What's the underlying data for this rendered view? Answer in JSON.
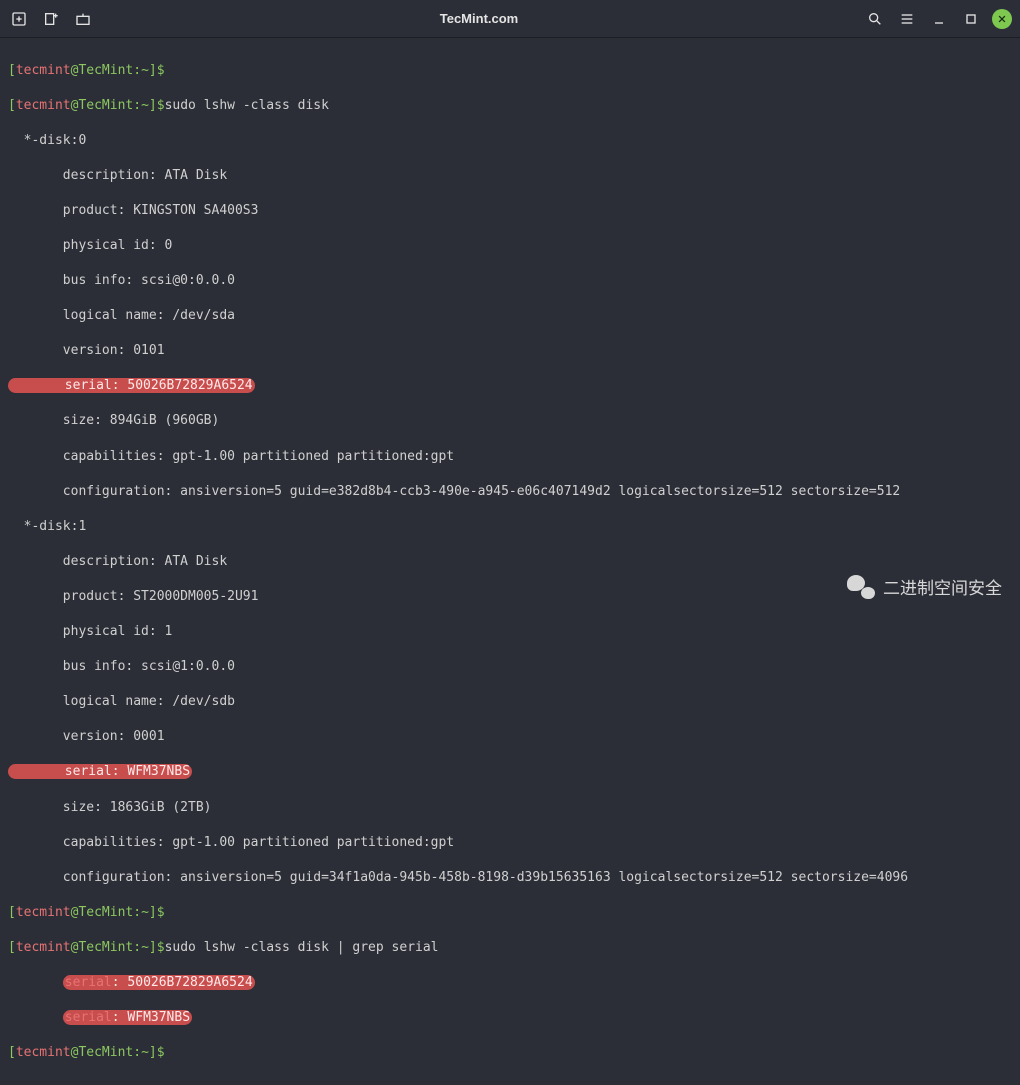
{
  "title": "TecMint.com",
  "prompt": {
    "bracket_open": "[",
    "bracket_close": "]",
    "user": "tecmint",
    "at": "@",
    "host": "TecMint",
    "path": ":~",
    "dollar": "$"
  },
  "cmd1": "sudo lshw -class disk",
  "cmd2": "sudo lshw -class disk | grep serial",
  "disk0": {
    "header": "  *-disk:0",
    "description": "       description: ATA Disk",
    "product": "       product: KINGSTON SA400S3",
    "physical_id": "       physical id: 0",
    "bus": "       bus info: scsi@0:0.0.0",
    "logical": "       logical name: /dev/sda",
    "version": "       version: 0101",
    "serial_label": "       serial: ",
    "serial_value": "50026B72829A6524",
    "size": "       size: 894GiB (960GB)",
    "caps": "       capabilities: gpt-1.00 partitioned partitioned:gpt",
    "config": "       configuration: ansiversion=5 guid=e382d8b4-ccb3-490e-a945-e06c407149d2 logicalsectorsize=512 sectorsize=512"
  },
  "disk1": {
    "header": "  *-disk:1",
    "description": "       description: ATA Disk",
    "product": "       product: ST2000DM005-2U91",
    "physical_id": "       physical id: 1",
    "bus": "       bus info: scsi@1:0.0.0",
    "logical": "       logical name: /dev/sdb",
    "version": "       version: 0001",
    "serial_label": "       serial: ",
    "serial_value": "WFM37NBS",
    "size": "       size: 1863GiB (2TB)",
    "caps": "       capabilities: gpt-1.00 partitioned partitioned:gpt",
    "config": "       configuration: ansiversion=5 guid=34f1a0da-945b-458b-8198-d39b15635163 logicalsectorsize=512 sectorsize=4096"
  },
  "grep": {
    "indent": "       ",
    "serial_word": "serial",
    "colon": ": ",
    "v1": "50026B72829A6524",
    "v2": "WFM37NBS"
  },
  "watermark": "二进制空间安全"
}
